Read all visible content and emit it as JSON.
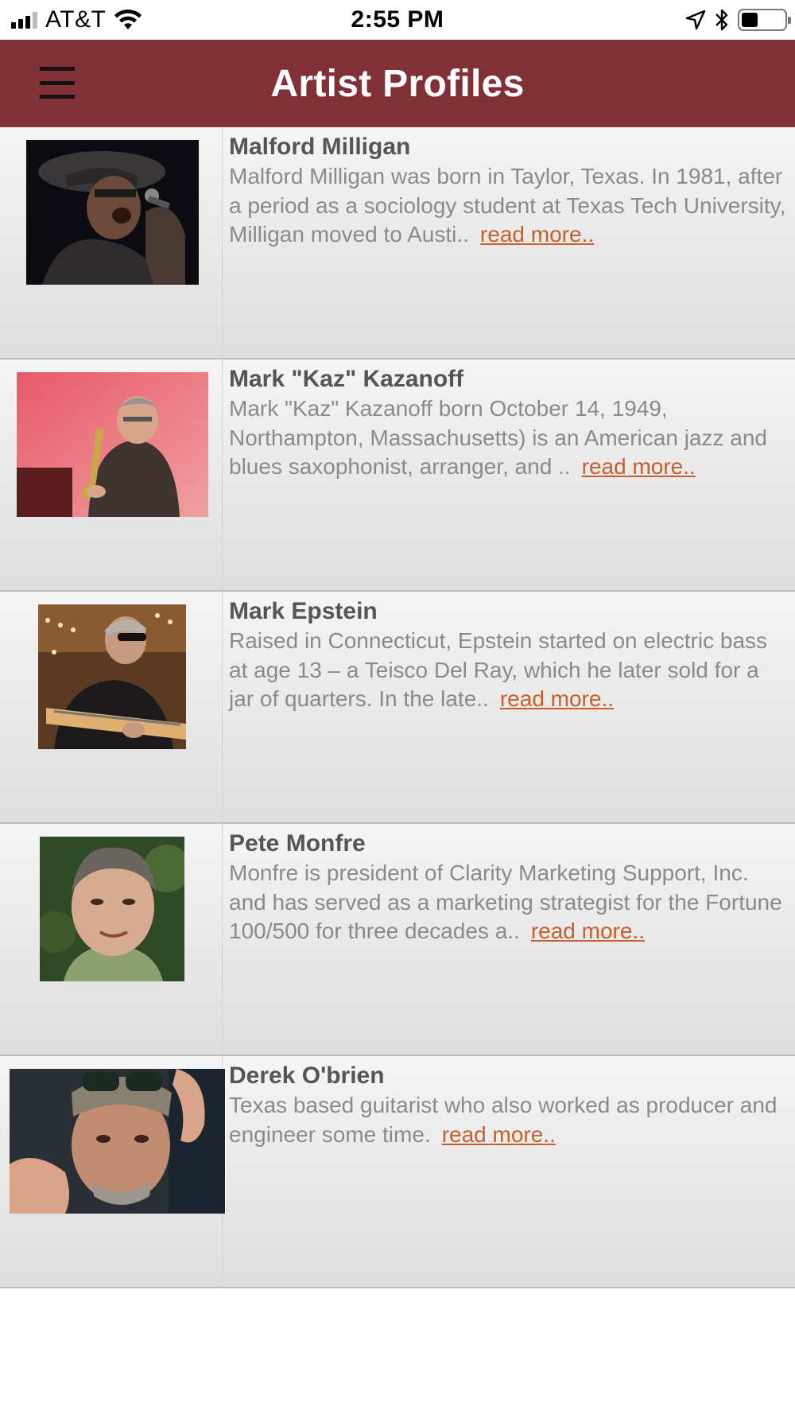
{
  "status_bar": {
    "carrier": "AT&T",
    "time": "2:55 PM",
    "icons": [
      "signal-icon",
      "wifi-icon",
      "location-arrow-icon",
      "bluetooth-icon",
      "battery-icon"
    ]
  },
  "header": {
    "title": "Artist Profiles",
    "menu_icon": "hamburger-menu-icon",
    "background": "#813035"
  },
  "colors": {
    "link": "#c85e2c",
    "name": "#555555",
    "description": "#8a8a8a"
  },
  "artists": [
    {
      "name": "Malford Milligan",
      "description": "Malford Milligan was born in Taylor, Texas. In 1981, after a period as a sociology student at Texas Tech University, Milligan moved to Austi..",
      "link": "read more.."
    },
    {
      "name": "Mark \"Kaz\" Kazanoff",
      "description": "Mark \"Kaz\" Kazanoff born October 14, 1949, Northampton, Massachusetts) is an American jazz and blues saxophonist, arranger, and ..",
      "link": "read more.."
    },
    {
      "name": "Mark Epstein",
      "description": "Raised in Connecticut, Epstein started on electric bass at age 13 – a Teisco Del Ray, which he later sold for a jar of quarters. In the late..",
      "link": "read more.."
    },
    {
      "name": "Pete Monfre",
      "description": "Monfre is president of Clarity Marketing Support, Inc. and has served as a marketing strategist for the Fortune 100/500 for three decades a..",
      "link": "read more.."
    },
    {
      "name": "Derek O'brien",
      "description": "Texas based guitarist who also worked as producer and engineer some time.",
      "link": "read more.."
    }
  ]
}
